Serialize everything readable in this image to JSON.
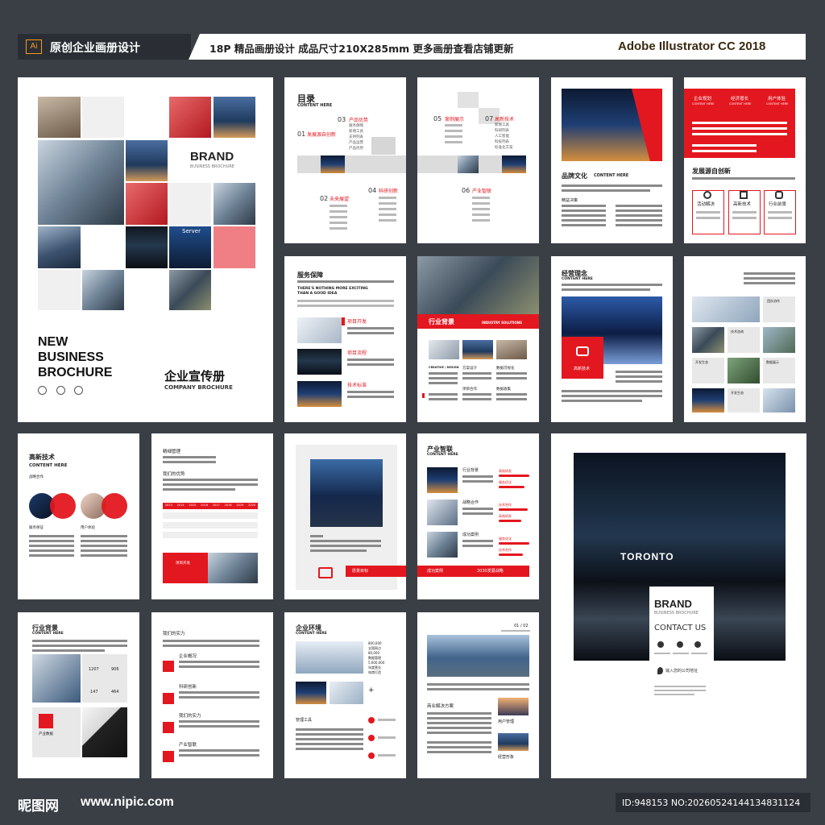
{
  "header": {
    "ai_badge": "Ai",
    "left_title": "原创企业画册设计",
    "center_text": "18P 精品画册设计  成品尺寸210X285mm  更多画册查看店铺更新",
    "right_text": "Adobe Illustrator CC 2018"
  },
  "cover": {
    "brand": "BRAND",
    "brand_sub": "BUSINESS BROCHURE",
    "server_label": "Server",
    "headline": [
      "NEW",
      "BUSINESS",
      "BROCHURE"
    ],
    "cn_title": "企业宣传册",
    "en_title": "COMPANY BROCHURE"
  },
  "toc": {
    "title": "目录",
    "subtitle": "CONTENT HERE",
    "items": [
      {
        "num": "01",
        "label": "发展源自创新"
      },
      {
        "num": "02",
        "label": "未来展望"
      },
      {
        "num": "03",
        "label": "产品优势"
      },
      {
        "num": "04",
        "label": "科研创新"
      },
      {
        "num": "05",
        "label": "案例展示"
      },
      {
        "num": "06",
        "label": "产业智联"
      },
      {
        "num": "07",
        "label": "高新技术"
      }
    ],
    "sub_items_a": [
      "服务保障",
      "新增工具",
      "支持列表",
      "产品运营",
      "产品优势"
    ],
    "sub_items_b": [
      "新增工具",
      "科研列表",
      "人工智能",
      "科技列表",
      "标准化方案"
    ]
  },
  "brand_culture": {
    "title": "品牌文化",
    "subtitle": "CONTENT HERE",
    "small": "精益决策"
  },
  "innovation": {
    "top_labels": [
      "企业规划",
      "经济增长",
      "用户体验"
    ],
    "top_sub": "CONTENT HERE",
    "title": "发展源自创新",
    "icons": [
      "活动解决",
      "高新技术",
      "行业前景"
    ]
  },
  "service": {
    "title": "服务保障",
    "tagline": [
      "THERE'S NOTHING MORE EXCITING",
      "THAN A GOOD IDEA"
    ],
    "items": [
      "项目开发",
      "项目流程",
      "技术标准"
    ]
  },
  "industry": {
    "banner": "行业背景",
    "banner_en": "INDUSTRY SOLUTIONS",
    "creative": "CREATIVE / DESIGN",
    "labels": [
      "方案设计",
      "数据可视化",
      "项目合作",
      "数据收集"
    ]
  },
  "philosophy": {
    "title": "经营理念",
    "subtitle": "CONTENT HERE",
    "tag": "高新技术"
  },
  "gallery": {
    "labels": [
      "团队协作",
      "技术咨询",
      "开发生态",
      "数据展示",
      "开发生态",
      "行业开发"
    ]
  },
  "hightech": {
    "title": "高新技术",
    "subtitle": "CONTENT HERE",
    "small": "战略合作",
    "items": [
      "服务保证",
      "用户体验"
    ]
  },
  "management": {
    "title": "精细管理",
    "sub": "我们的优势",
    "table_headers": [
      "2013",
      "2014",
      "2015",
      "2016",
      "2017",
      "2018",
      "2019",
      "2020"
    ],
    "banner": "项目开发"
  },
  "vision": {
    "banner": "愿景目标"
  },
  "smart": {
    "title": "产业智联",
    "subtitle": "CONTENT HERE",
    "items": [
      "行业背景",
      "战略合作",
      "成功案例"
    ],
    "tags": [
      "高效研发",
      "服务优化",
      "技术合作",
      "高效研发",
      "服务优化",
      "技术合作"
    ],
    "banner_left": "成功案例",
    "banner_right": "2030发展战略"
  },
  "back_cover": {
    "city": "TORONTO",
    "brand": "BRAND",
    "brand_sub": "BUSINESS BROCHURE",
    "contact": "CONTACT US",
    "address": "输入您的公司地址"
  },
  "industry2": {
    "title": "行业背景",
    "subtitle": "CONTENT HERE",
    "stats": [
      "1207",
      "906",
      "147",
      "464"
    ],
    "tag": "产业数据"
  },
  "strength": {
    "title": "我们的实力",
    "items": [
      "企业概况",
      "科研创新",
      "我们的实力",
      "产业智联"
    ]
  },
  "environment": {
    "title": "企业环境",
    "subtitle": "CONTENT HERE",
    "stats": [
      "800,000",
      "全国网点",
      "80,000",
      "数据管理",
      "5,600,000",
      "年度营业",
      "电商打造"
    ],
    "tool": "管理工具"
  },
  "solutions": {
    "page": "01 / 02",
    "title": "商业解决方案",
    "items": [
      "用户管理",
      "经营形象"
    ]
  },
  "footer": {
    "logo": "昵图网",
    "url": "www.nipic.com",
    "id": "ID:948153 NO:20260524144134831124"
  }
}
